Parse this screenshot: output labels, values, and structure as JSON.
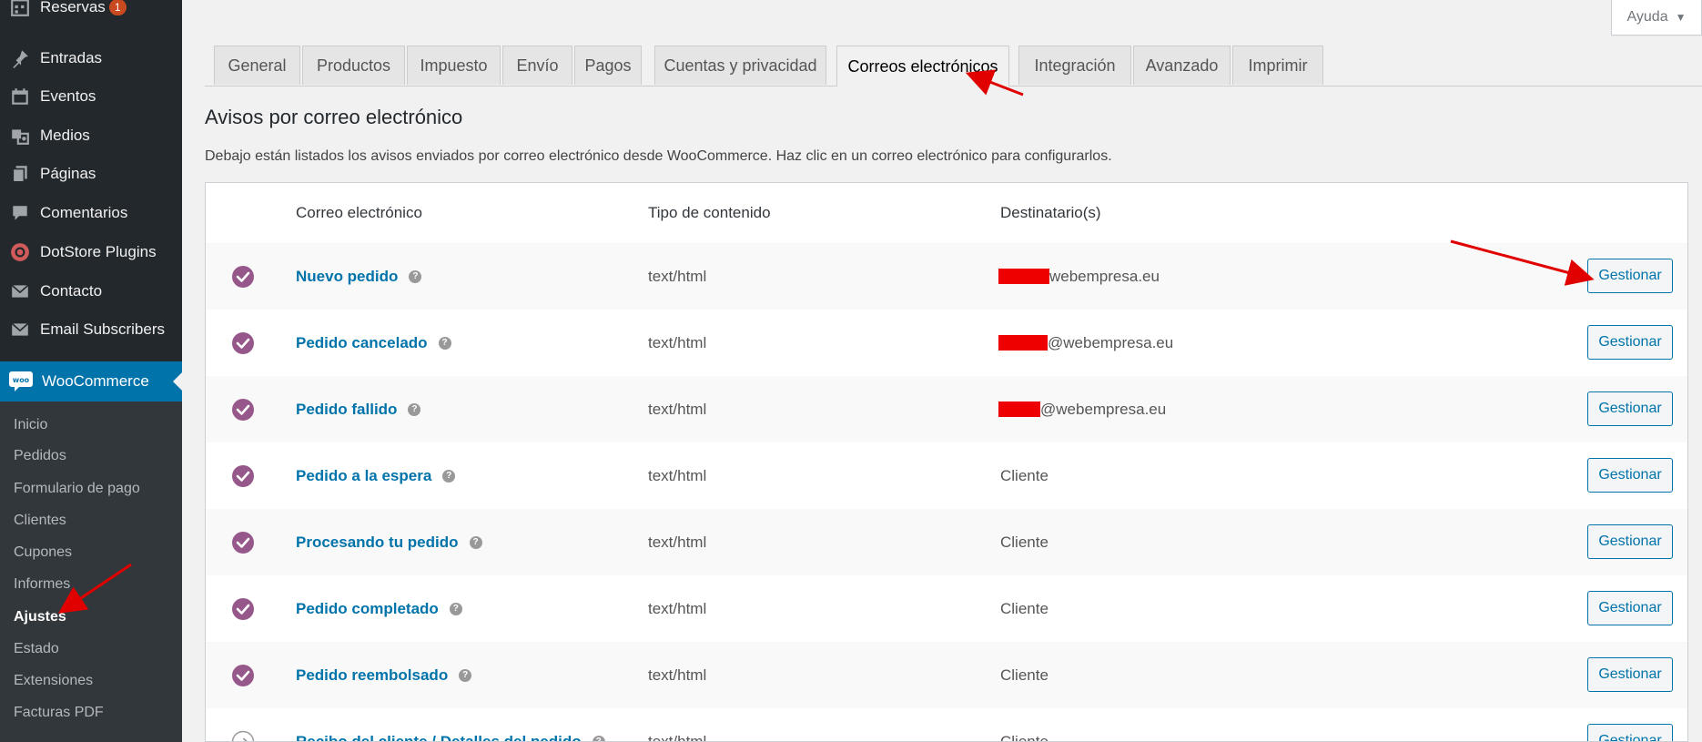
{
  "sidebar": {
    "reservas_badge": "1",
    "items": [
      {
        "label": "Reservas",
        "icon": "calendar-grid-icon"
      },
      {
        "label": "Entradas",
        "icon": "pushpin-icon"
      },
      {
        "label": "Eventos",
        "icon": "calendar-icon"
      },
      {
        "label": "Medios",
        "icon": "media-icon"
      },
      {
        "label": "Páginas",
        "icon": "pages-icon"
      },
      {
        "label": "Comentarios",
        "icon": "comment-icon"
      },
      {
        "label": "DotStore Plugins",
        "icon": "dotstore-icon"
      },
      {
        "label": "Contacto",
        "icon": "envelope-icon"
      },
      {
        "label": "Email Subscribers",
        "icon": "envelope-icon"
      }
    ],
    "woocommerce": {
      "label": "WooCommerce",
      "icon_text": "woo"
    },
    "submenu": [
      "Inicio",
      "Pedidos",
      "Formulario de pago",
      "Clientes",
      "Cupones",
      "Informes",
      "Ajustes",
      "Estado",
      "Extensiones",
      "Facturas PDF"
    ],
    "current_submenu": "Ajustes"
  },
  "help": {
    "label": "Ayuda",
    "caret": "▼"
  },
  "tabs": [
    "General",
    "Productos",
    "Impuesto",
    "Envío",
    "Pagos",
    "Cuentas y privacidad",
    "Correos electrónicos",
    "Integración",
    "Avanzado",
    "Imprimir"
  ],
  "active_tab": "Correos electrónicos",
  "section": {
    "title": "Avisos por correo electrónico",
    "description": "Debajo están listados los avisos enviados por correo electrónico desde WooCommerce. Haz clic en un correo electrónico para configurarlos."
  },
  "table": {
    "headers": [
      "Correo electrónico",
      "Tipo de contenido",
      "Destinatario(s)"
    ],
    "rows": [
      {
        "name": "Nuevo pedido",
        "type": "text/html",
        "recipient": "webempresa.eu",
        "redacted": true,
        "enabled": true
      },
      {
        "name": "Pedido cancelado",
        "type": "text/html",
        "recipient": "@webempresa.eu",
        "redacted": true,
        "enabled": true
      },
      {
        "name": "Pedido fallido",
        "type": "text/html",
        "recipient": "@webempresa.eu",
        "redacted": true,
        "enabled": true
      },
      {
        "name": "Pedido a la espera",
        "type": "text/html",
        "recipient": "Cliente",
        "redacted": false,
        "enabled": true
      },
      {
        "name": "Procesando tu pedido",
        "type": "text/html",
        "recipient": "Cliente",
        "redacted": false,
        "enabled": true
      },
      {
        "name": "Pedido completado",
        "type": "text/html",
        "recipient": "Cliente",
        "redacted": false,
        "enabled": true
      },
      {
        "name": "Pedido reembolsado",
        "type": "text/html",
        "recipient": "Cliente",
        "redacted": false,
        "enabled": true
      },
      {
        "name": "Recibo del cliente / Detalles del pedido",
        "type": "text/html",
        "recipient": "Cliente",
        "redacted": false,
        "enabled": false
      }
    ],
    "manage_label": "Gestionar",
    "help_tip": "?"
  },
  "colors": {
    "sidebar_bg": "#23282d",
    "submenu_bg": "#32373c",
    "accent": "#0073aa",
    "check_purple": "#96588a",
    "annotation_red": "#e00000"
  }
}
